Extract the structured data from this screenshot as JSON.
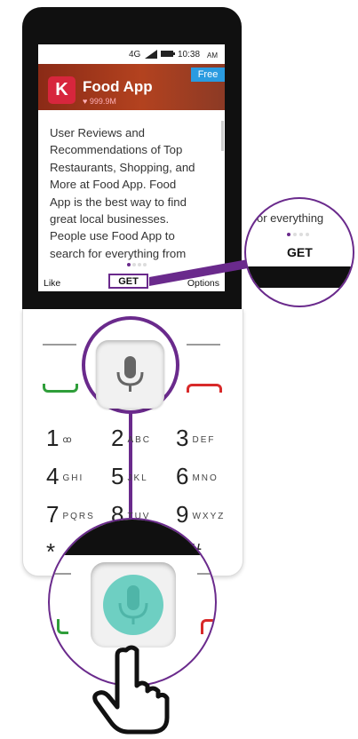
{
  "status_bar": {
    "network": "4G",
    "time": "10:38",
    "ampm": "AM"
  },
  "app": {
    "logo_letter": "K",
    "name": "Food App",
    "rating": "999.9M",
    "badge": "Free",
    "description": [
      "User Reviews and",
      "Recommendations of Top",
      "Restaurants, Shopping, and",
      "More at Food App. Food",
      "App is the best way to find",
      "great local businesses.",
      "People use Food App to",
      "search for everything from"
    ]
  },
  "softkeys": {
    "left": "Like",
    "center": "GET",
    "right": "Options"
  },
  "zoom_callout": {
    "snippet": "or everything",
    "get_label": "GET"
  },
  "keypad": {
    "keys": [
      {
        "digit": "1",
        "letters": "ꝏ"
      },
      {
        "digit": "2",
        "letters": "ABC"
      },
      {
        "digit": "3",
        "letters": "DEF"
      },
      {
        "digit": "4",
        "letters": "GHI"
      },
      {
        "digit": "5",
        "letters": "JKL"
      },
      {
        "digit": "6",
        "letters": "MNO"
      },
      {
        "digit": "7",
        "letters": "PQRS"
      },
      {
        "digit": "8",
        "letters": "TUV"
      },
      {
        "digit": "9",
        "letters": "WXYZ"
      },
      {
        "digit": "*",
        "letters": ""
      },
      {
        "digit": "#",
        "letters": ""
      }
    ]
  },
  "colors": {
    "highlight": "#6a2a8c",
    "call_green": "#2f9e3a",
    "end_red": "#d82a2a",
    "mic_active": "#6ecfc2"
  },
  "icons": [
    "microphone-icon",
    "heart-icon",
    "hand-pointer-icon",
    "voicemail-icon"
  ]
}
